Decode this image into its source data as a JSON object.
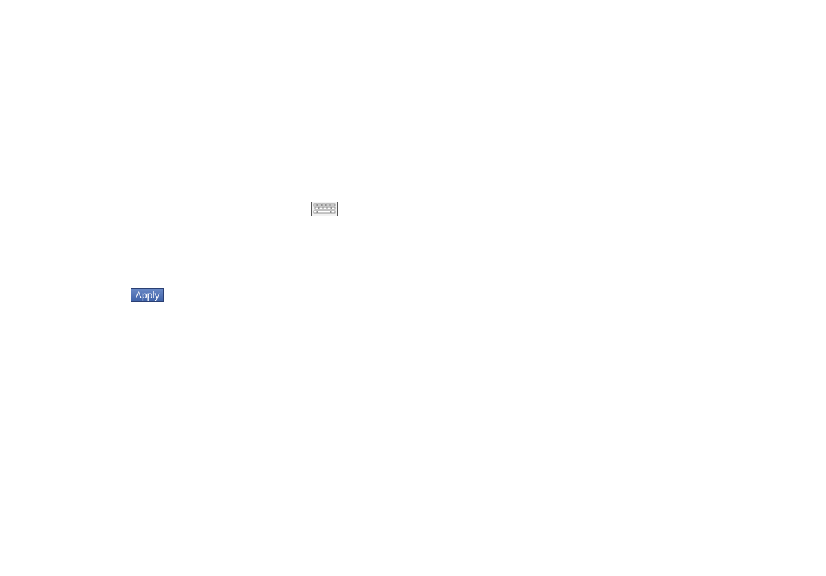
{
  "apply_button": {
    "label": "Apply"
  },
  "icons": {
    "keyboard": "keyboard-icon"
  },
  "colors": {
    "apply_button_bg": "#4a6db3",
    "apply_button_text": "#ffffff",
    "rule": "#1a1a1a"
  }
}
